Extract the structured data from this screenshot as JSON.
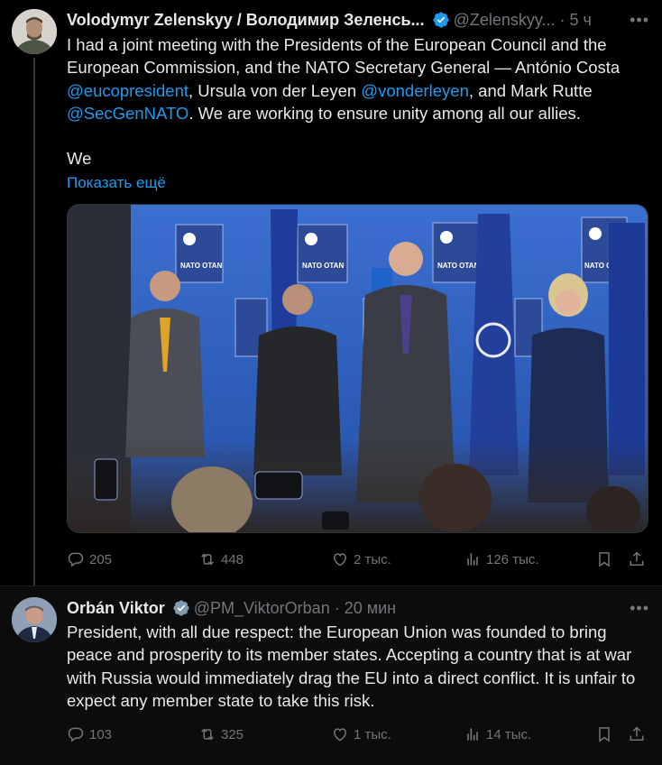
{
  "tweet1": {
    "author": "Volodymyr Zelenskyy / Володимир Зеленсь...",
    "handle": "@Zelenskyy...",
    "time": "5 ч",
    "text_line1": "I had a joint meeting with the Presidents of the European Council and the European Commission, and the NATO Secretary General — António Costa",
    "mention1": "@eucopresident",
    "text_mid1": ", Ursula von der Leyen",
    "mention2": "@vonderleyen",
    "text_mid2": ", and Mark Rutte",
    "mention3": "@SecGenNATO",
    "text_end": ". We are working to ensure unity among all our allies.",
    "text_second": "We",
    "show_more": "Показать ещё",
    "image_text": {
      "flag_label": "NATO OTAN"
    },
    "stats": {
      "replies": "205",
      "reposts": "448",
      "likes": "2 тыс.",
      "views": "126 тыс."
    }
  },
  "tweet2": {
    "author": "Orbán Viktor",
    "handle": "@PM_ViktorOrban",
    "time": "20 мин",
    "text": "President, with all due respect: the European Union was founded to bring peace and prosperity to its member states. Accepting a country that is at war with Russia would immediately drag the EU into a direct conflict. It is unfair to expect any member state to take this risk.",
    "stats": {
      "replies": "103",
      "reposts": "325",
      "likes": "1 тыс.",
      "views": "14 тыс."
    }
  },
  "colors": {
    "accent": "#1d9bf0",
    "muted": "#71767b",
    "text": "#e7e9ea",
    "background": "#000000"
  },
  "icons": [
    "verified-badge-icon",
    "more-icon",
    "reply-icon",
    "repost-icon",
    "like-icon",
    "views-icon",
    "bookmark-icon",
    "share-icon"
  ]
}
